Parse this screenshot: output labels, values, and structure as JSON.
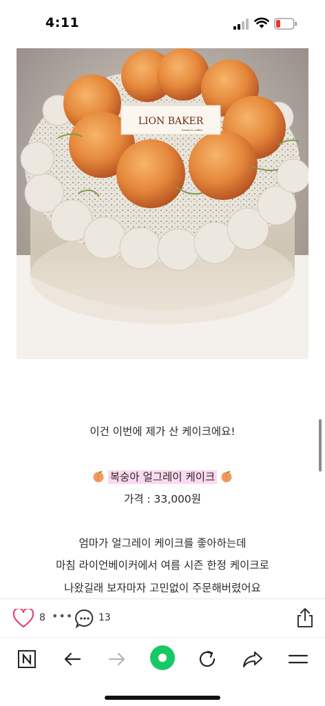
{
  "status_bar": {
    "time": "4:11",
    "battery_color": "#e53935"
  },
  "photo": {
    "alt": "peach earl grey cake",
    "cake_tag": {
      "title": "LION BAKER",
      "subtitle": "bread & coffee"
    }
  },
  "article": {
    "line1": "이건 이번에 제가 산 케이크에요!",
    "cake_name": "복숭아 얼그레이 케이크",
    "price": "가격 : 33,000원",
    "body_lines": [
      "엄마가 얼그레이 케이크를 좋아하는데",
      "마침 라이언베이커에서 여름 시즌 한정 케이크로",
      "나왔길래 보자마자 고민없이 주문해버렸어요"
    ],
    "highlight_color": "#fbd9ee"
  },
  "engagement": {
    "like_count": "8",
    "more_label": "•••",
    "comment_count": "13",
    "heart_color": "#e5416f"
  },
  "nav": {
    "home_color": "#17c964",
    "icons": [
      "naver-n-icon",
      "back-arrow-icon",
      "forward-arrow-icon",
      "home-icon",
      "refresh-icon",
      "share-arrow-icon",
      "menu-icon"
    ]
  }
}
